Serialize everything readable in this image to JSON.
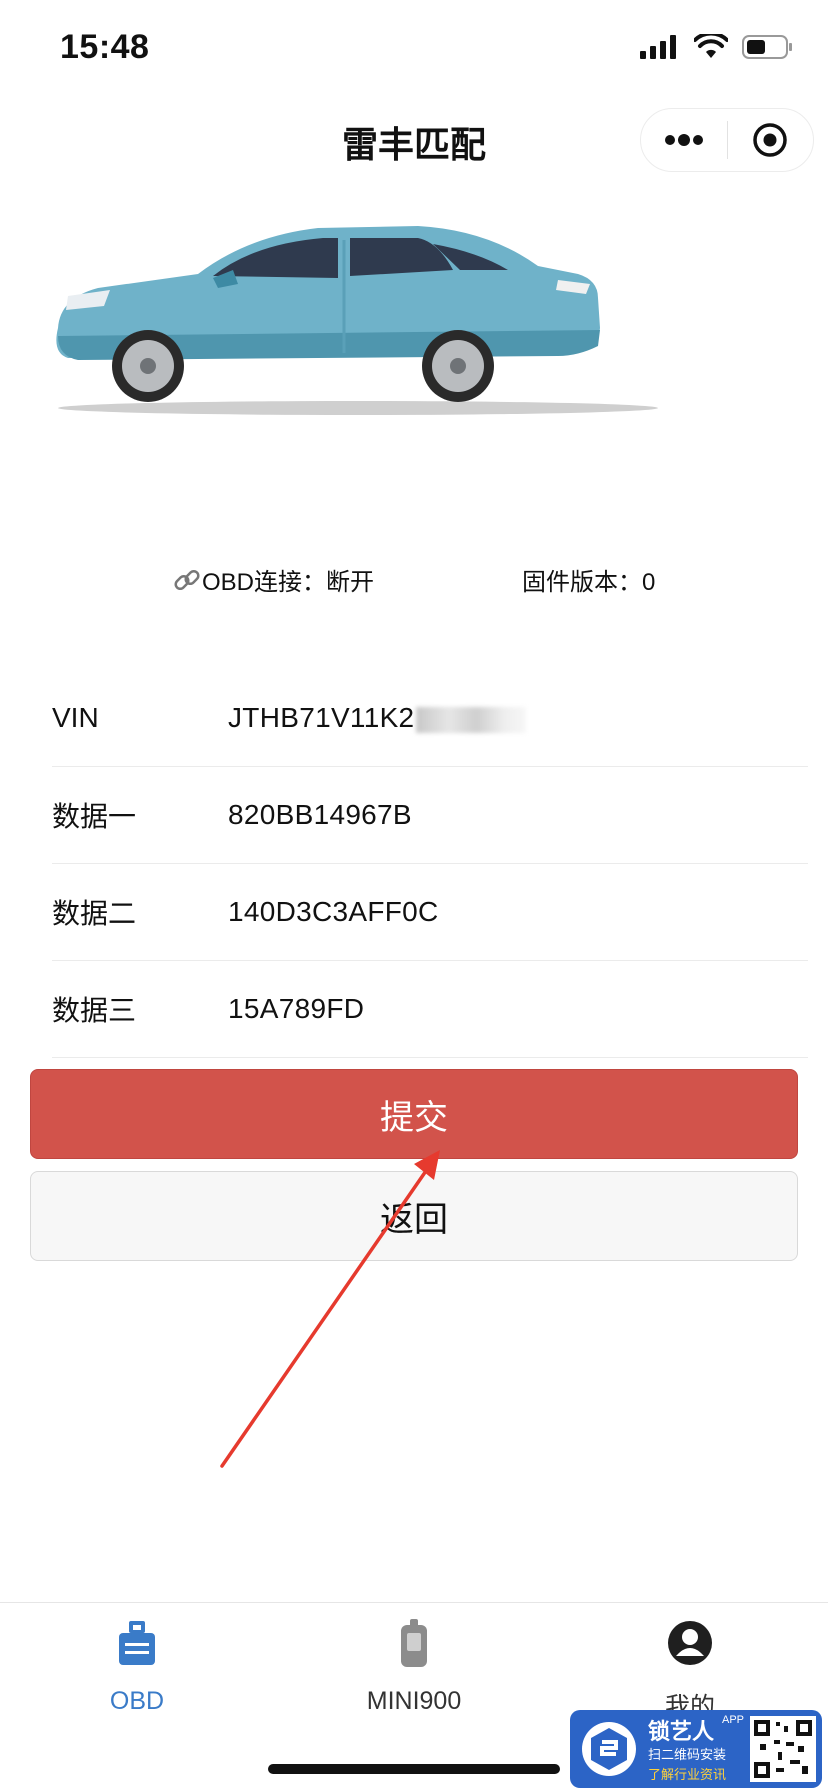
{
  "status_bar": {
    "time": "15:48"
  },
  "nav": {
    "title": "雷丰匹配"
  },
  "connection": {
    "obd_label": "OBD连接：断开",
    "firmware_label": "固件版本：0"
  },
  "fields": [
    {
      "label": "VIN",
      "value": "JTHB71V11K2"
    },
    {
      "label": "数据一",
      "value": "820BB14967B"
    },
    {
      "label": "数据二",
      "value": "140D3C3AFF0C"
    },
    {
      "label": "数据三",
      "value": "15A789FD"
    }
  ],
  "buttons": {
    "submit": "提交",
    "back": "返回"
  },
  "tabs": [
    {
      "label": "OBD",
      "icon": "obd-icon",
      "active": true
    },
    {
      "label": "MINI900",
      "icon": "mini900-device-icon",
      "active": false
    },
    {
      "label": "我的",
      "icon": "user-icon",
      "active": false
    }
  ],
  "watermark": {
    "brand": "锁艺人",
    "app_tag": "APP",
    "line1": "扫二维码安装",
    "line2": "了解行业资讯"
  },
  "colors": {
    "primary_button": "#d2534b",
    "tab_active": "#3a7bc8",
    "arrow": "#e63a2e"
  }
}
